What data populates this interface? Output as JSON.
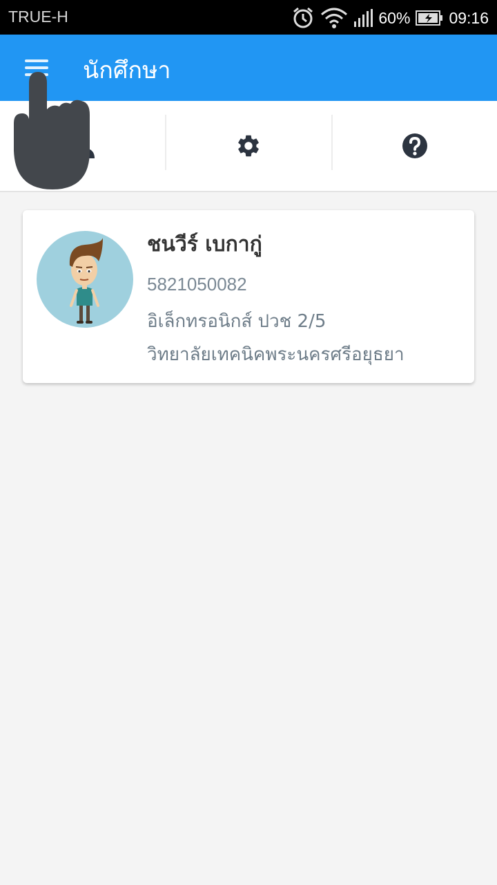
{
  "status_bar": {
    "carrier": "TRUE-H",
    "battery": "60%",
    "time": "09:16",
    "icons": [
      "alarm-icon",
      "wifi-icon",
      "signal-icon",
      "battery-charging-icon"
    ]
  },
  "app_bar": {
    "title": "นักศึกษา",
    "menu_icon": "menu-icon",
    "color": "#2196f3"
  },
  "toolbar": {
    "items": [
      {
        "icon": "person-icon"
      },
      {
        "icon": "gear-icon"
      },
      {
        "icon": "help-icon"
      }
    ]
  },
  "profile": {
    "name": "ชนวีร์ เบกากู่",
    "student_id": "5821050082",
    "program": "อิเล็กทรอนิกส์ ปวช 2/5",
    "college": "วิทยาลัยเทคนิคพระนครศรีอยุธยา"
  }
}
